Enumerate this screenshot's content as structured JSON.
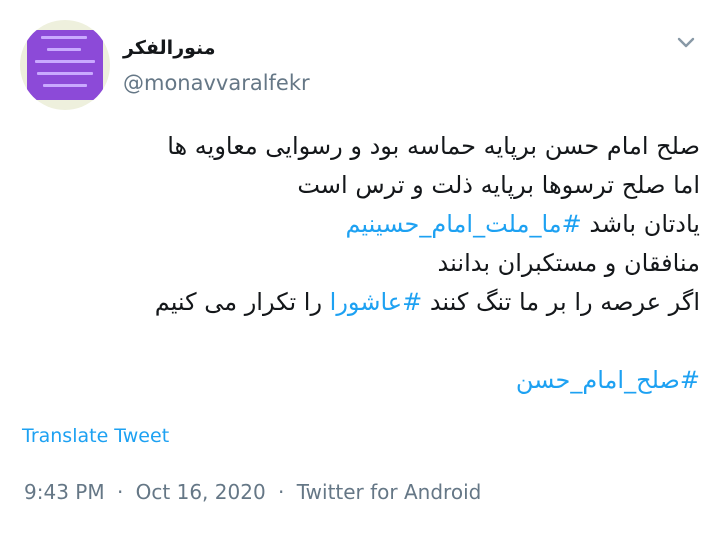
{
  "user": {
    "display_name": "منورالفکر",
    "handle": "@monavvaralfekr"
  },
  "tweet": {
    "line1": "صلح امام حسن برپایه حماسه بود و رسوایی معاویه ها",
    "line2": "اما صلح ترسوها برپایه ذلت و ترس است",
    "line3_text": "یادتان باشد ",
    "line3_tag": "#ما_ملت_امام_حسینیم",
    "line4": "منافقان و مستکبران بدانند",
    "line5_pre": "اگر عرصه را بر ما تنگ کنند ",
    "line5_tag": "#عاشورا",
    "line5_post": " را تکرار می کنیم",
    "line7_tag": "#صلح_امام_حسن"
  },
  "translate_label": "Translate Tweet",
  "meta": {
    "time": "9:43 PM",
    "separator": "·",
    "date": "Oct 16, 2020",
    "source": "Twitter for Android"
  },
  "colors": {
    "link": "#1da1f2",
    "secondary": "#657786",
    "text": "#14171a"
  },
  "icons": {
    "menu": "chevron-down-icon",
    "avatar": "profile-image"
  }
}
